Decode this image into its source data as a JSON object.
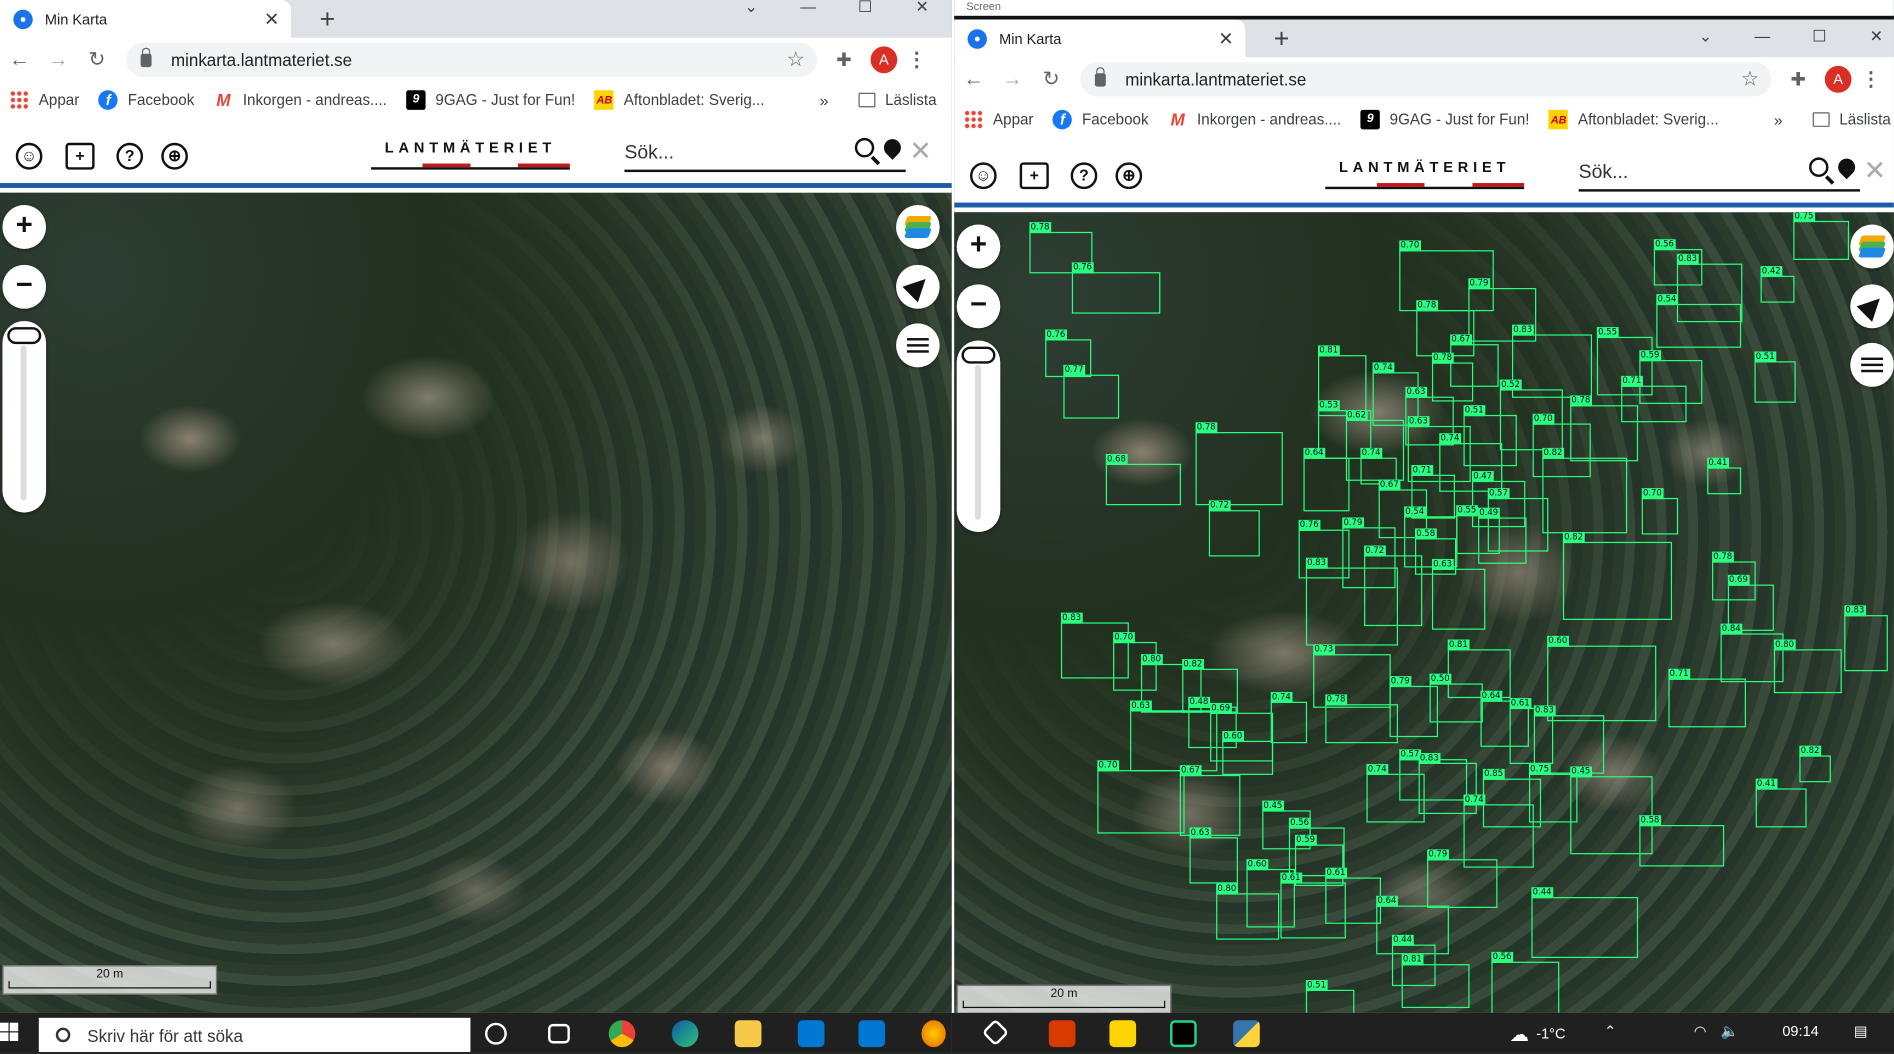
{
  "left": {
    "tab_title": "Min Karta",
    "url": "minkarta.lantmateriet.se",
    "avatar_letter": "A",
    "bookmarks": [
      "Appar",
      "Facebook",
      "Inkorgen - andreas....",
      "9GAG - Just for Fun!",
      "Aftonbladet: Sverig..."
    ],
    "more": "»",
    "reading_list": "Läslista",
    "logo": "LANTMÄTERIET",
    "search_placeholder": "Sök...",
    "scale": "20 m"
  },
  "right": {
    "tab_title": "Min Karta",
    "url": "minkarta.lantmateriet.se",
    "avatar_letter": "A",
    "bookmarks": [
      "Appar",
      "Facebook",
      "Inkorgen - andreas....",
      "9GAG - Just for Fun!",
      "Aftonbladet: Sverig..."
    ],
    "more": "»",
    "reading_list": "Läslista",
    "logo": "LANTMÄTERIET",
    "search_placeholder": "Sök...",
    "scale": "20 m",
    "top_label": "Screen"
  },
  "taskbar": {
    "search_placeholder": "Skriv här för att söka",
    "temperature": "-1°C",
    "time": "09:14"
  },
  "detections": [
    "0.78",
    "0.76",
    "0.76",
    "0.77",
    "0.70",
    "0.79",
    "0.78",
    "0.67",
    "0.83",
    "0.55",
    "0.59",
    "0.56",
    "0.83",
    "0.42",
    "0.75",
    "0.54",
    "0.51",
    "0.71",
    "0.81",
    "0.74",
    "0.78",
    "0.63",
    "0.52",
    "0.53",
    "0.62",
    "0.63",
    "0.51",
    "0.70",
    "0.78",
    "0.74",
    "0.68",
    "0.78",
    "0.64",
    "0.74",
    "0.82",
    "0.41",
    "0.71",
    "0.47",
    "0.67",
    "0.57",
    "0.70",
    "0.72",
    "0.54",
    "0.55",
    "0.49",
    "0.76",
    "0.79",
    "0.58",
    "0.82",
    "0.83",
    "0.72",
    "0.78",
    "0.63",
    "0.69",
    "0.83",
    "0.84",
    "0.83",
    "0.70",
    "0.73",
    "0.81",
    "0.60",
    "0.80",
    "0.71",
    "0.80",
    "0.82",
    "0.50",
    "0.79",
    "0.48",
    "0.74",
    "0.69",
    "0.78",
    "0.63",
    "0.64",
    "0.61",
    "0.60",
    "0.57",
    "0.83",
    "0.83",
    "0.70",
    "0.67",
    "0.74",
    "0.85",
    "0.45",
    "0.82",
    "0.41",
    "0.75",
    "0.45",
    "0.74",
    "0.56",
    "0.58",
    "0.63",
    "0.59",
    "0.60",
    "0.61",
    "0.61",
    "0.79",
    "0.80",
    "0.64",
    "0.44",
    "0.44",
    "0.81",
    "0.56",
    "0.51"
  ]
}
